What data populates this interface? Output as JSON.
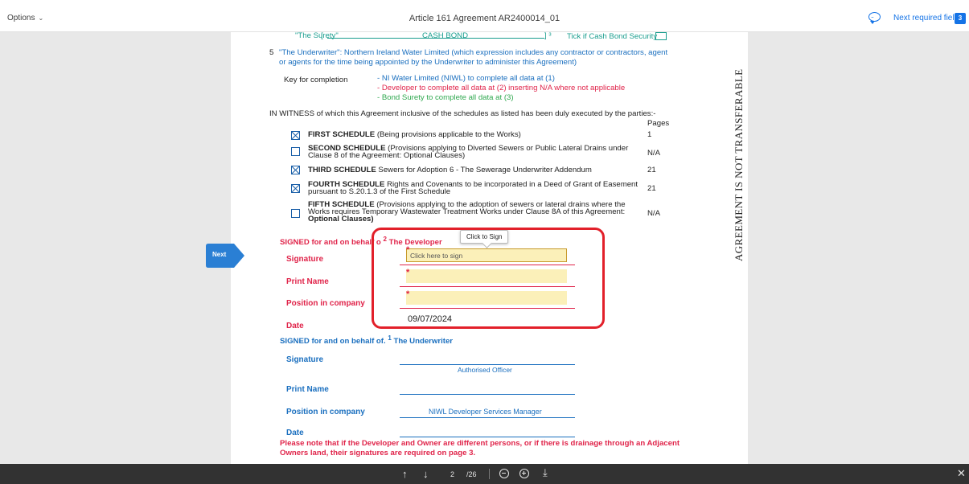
{
  "topbar": {
    "options_label": "Options",
    "title": "Article 161 Agreement AR2400014_01",
    "next_required_label": "Next required field",
    "next_required_count": "3"
  },
  "doc": {
    "surety_label": "\"The Surety\"",
    "surety_value": "CASH BOND",
    "tick_label": "Tick if Cash Bond Security",
    "underwriter_num": "5",
    "underwriter_line1": "\"The Underwriter\": Northern Ireland Water Limited (which expression includes any contractor or contractors, agent",
    "underwriter_line2": "or agents for the time being appointed by the Underwriter to administer this Agreement)",
    "key_label": "Key for completion",
    "key_1": "- NI Water Limited (NIWL) to complete all data at (1)",
    "key_2": "- Developer to complete all data at (2) inserting N/A where not applicable",
    "key_3": "- Bond Surety to complete all data at (3)",
    "witness": "IN WITNESS of which this Agreement inclusive of the schedules as listed has been duly executed by the parties:-",
    "pages_header": "Pages",
    "schedules": [
      {
        "title": "FIRST SCHEDULE",
        "line1": " (Being provisions applicable to the Works)",
        "line2": "",
        "line3": "",
        "pages": "1",
        "checked": true
      },
      {
        "title": "SECOND SCHEDULE",
        "line1": " (Provisions applying to Diverted Sewers or Public Lateral Drains under",
        "line2": "Clause 8 of the Agreement: Optional Clauses)",
        "line3": "",
        "pages": "N/A",
        "checked": false
      },
      {
        "title": "THIRD SCHEDULE",
        "line1": " Sewers for Adoption 6 - The Sewerage Underwriter Addendum",
        "line2": "",
        "line3": "",
        "pages": "21",
        "checked": true
      },
      {
        "title": "FOURTH SCHEDULE",
        "line1": " Rights and Covenants to be incorporated in a Deed of Grant of Easement",
        "line2": "pursuant to S.20.1.3 of the First Schedule",
        "line3": "",
        "pages": "21",
        "checked": true
      },
      {
        "title": "FIFTH SCHEDULE",
        "line1": " (Provisions applying to the adoption of sewers or lateral drains where the",
        "line2": "Works requires Temporary Wastewater Treatment Works under Clause 8A of this Agreement:",
        "line3": "Optional Clauses)",
        "pages": "N/A",
        "checked": false
      }
    ],
    "vertical_text": "AGREEMENT IS NOT TRANSFERABLE",
    "developer_heading_a": "SIGNED for and on behalf o",
    "developer_heading_sup": "2",
    "developer_heading_b": "The Developer",
    "tooltip": "Click to Sign",
    "dev_fields": {
      "signature": "Signature",
      "print_name": "Print Name",
      "position": "Position in company",
      "date": "Date"
    },
    "sign_placeholder": "Click here to sign",
    "required_mark": "*",
    "dev_date_value": "09/07/2024",
    "underwriter_heading_a": "SIGNED for and on behalf of.",
    "underwriter_heading_sup": "1",
    "underwriter_heading_b": "The Underwriter",
    "uw_fields": {
      "signature": "Signature",
      "signature_value": "Authorised Officer",
      "print_name": "Print Name",
      "position": "Position in company",
      "position_value": "NIWL Developer Services Manager",
      "date": "Date"
    },
    "note_line1": "Please note that if the Developer and Owner are different persons, or if there is drainage through an Adjacent",
    "note_line2": "Owners land, their signatures are required on page 3."
  },
  "next_tab_label": "Next",
  "bottombar": {
    "page_current": "2",
    "page_total": "/26"
  },
  "colors": {
    "accent": "#1473e6",
    "required_red": "#e0244a",
    "field_yellow": "#fbf0b9",
    "highlight_red": "#e2202a"
  }
}
